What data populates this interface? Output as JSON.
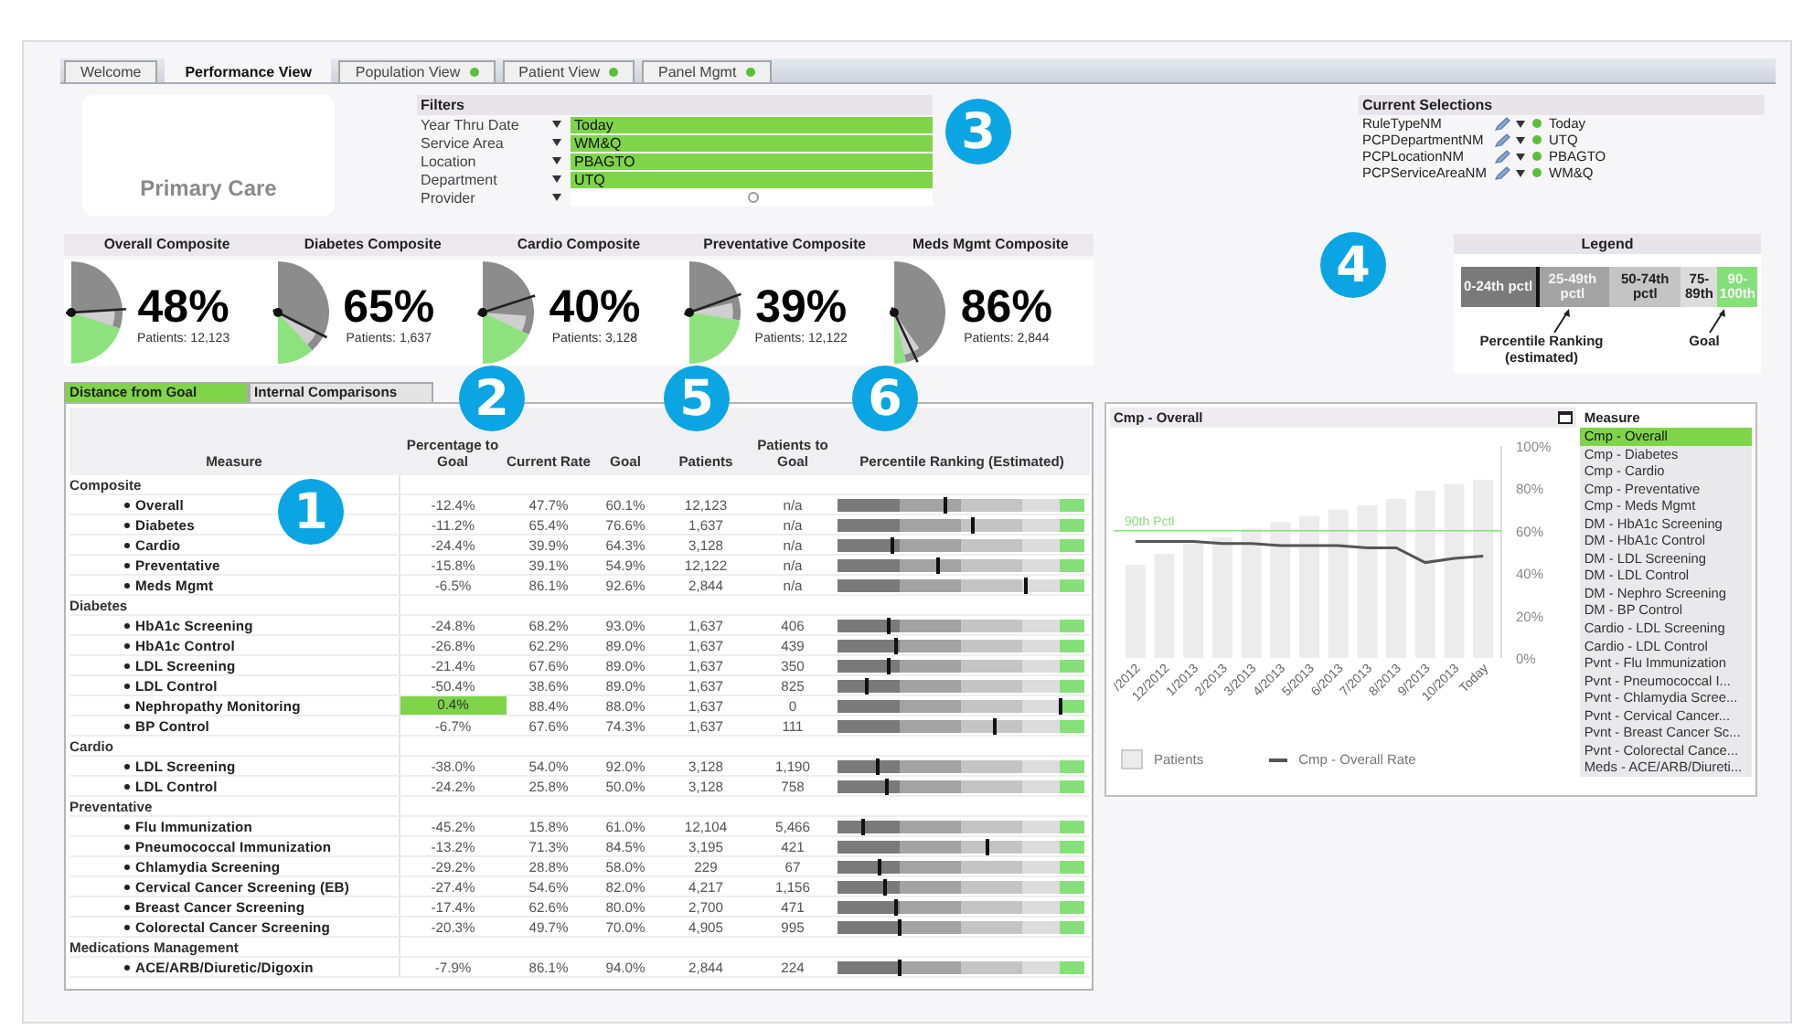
{
  "tabs": [
    {
      "label": "Welcome",
      "selected": false,
      "indicator": false
    },
    {
      "label": "Performance View",
      "selected": true,
      "indicator": false
    },
    {
      "label": "Population View",
      "selected": false,
      "indicator": true
    },
    {
      "label": "Patient View",
      "selected": false,
      "indicator": true
    },
    {
      "label": "Panel Mgmt",
      "selected": false,
      "indicator": true
    }
  ],
  "logo": {
    "title": "Primary Care"
  },
  "filters": {
    "title": "Filters",
    "rows": [
      {
        "label": "Year Thru Date",
        "value": "Today"
      },
      {
        "label": "Service Area",
        "value": "WM&Q"
      },
      {
        "label": "Location",
        "value": "PBAGTO"
      },
      {
        "label": "Department",
        "value": "UTQ"
      },
      {
        "label": "Provider"
      }
    ]
  },
  "current_selections": {
    "title": "Current Selections",
    "rows": [
      {
        "field": "RuleTypeNM",
        "value": "Today"
      },
      {
        "field": "PCPDepartmentNM",
        "value": "UTQ"
      },
      {
        "field": "PCPLocationNM",
        "value": "PBAGTO"
      },
      {
        "field": "PCPServiceAreaNM",
        "value": "WM&Q"
      }
    ]
  },
  "composites": [
    {
      "title": "Overall Composite",
      "value": "48%",
      "patients": "Patients: 12,123"
    },
    {
      "title": "Diabetes Composite",
      "value": "65%",
      "patients": "Patients: 1,637"
    },
    {
      "title": "Cardio Composite",
      "value": "40%",
      "patients": "Patients: 3,128"
    },
    {
      "title": "Preventative Composite",
      "value": "39%",
      "patients": "Patients: 12,122"
    },
    {
      "title": "Meds Mgmt Composite",
      "value": "86%",
      "patients": "Patients: 2,844"
    }
  ],
  "legend": {
    "title": "Legend",
    "segments": [
      {
        "label": "0-24th pctl",
        "color": "#7a7a7a"
      },
      {
        "label": "25-49th pctl",
        "color": "#a3a3a3"
      },
      {
        "label": "50-74th pctl",
        "color": "#c4c4c4"
      },
      {
        "label": "75-89th",
        "color": "#dcdcdc"
      },
      {
        "label": "90-100th",
        "color": "#86e07a"
      }
    ],
    "annotations": [
      "Percentile Ranking (estimated)",
      "Goal"
    ]
  },
  "measure_tabs": [
    {
      "label": "Distance from Goal",
      "selected": true
    },
    {
      "label": "Internal Comparisons",
      "selected": false
    }
  ],
  "table": {
    "columns": [
      "Measure",
      "Percentage to Goal",
      "Current Rate",
      "Goal",
      "Patients",
      "Patients to Goal",
      "Percentile Ranking (Estimated)"
    ],
    "groups": [
      {
        "name": "Composite",
        "rows": [
          {
            "measure": "Overall",
            "pct_to_goal": "-12.4%",
            "current_rate": "47.7%",
            "goal": "60.1%",
            "patients": "12,123",
            "patients_to_goal": "n/a",
            "level": 0.44,
            "highlighted": false
          },
          {
            "measure": "Diabetes",
            "pct_to_goal": "-11.2%",
            "current_rate": "65.4%",
            "goal": "76.6%",
            "patients": "1,637",
            "patients_to_goal": "n/a",
            "level": 0.55,
            "highlighted": false
          },
          {
            "measure": "Cardio",
            "pct_to_goal": "-24.4%",
            "current_rate": "39.9%",
            "goal": "64.3%",
            "patients": "3,128",
            "patients_to_goal": "n/a",
            "level": 0.22,
            "highlighted": false
          },
          {
            "measure": "Preventative",
            "pct_to_goal": "-15.8%",
            "current_rate": "39.1%",
            "goal": "54.9%",
            "patients": "12,122",
            "patients_to_goal": "n/a",
            "level": 0.41,
            "highlighted": false
          },
          {
            "measure": "Meds Mgmt",
            "pct_to_goal": "-6.5%",
            "current_rate": "86.1%",
            "goal": "92.6%",
            "patients": "2,844",
            "patients_to_goal": "n/a",
            "level": 0.76,
            "highlighted": false
          }
        ]
      },
      {
        "name": "Diabetes",
        "rows": [
          {
            "measure": "HbA1c Screening",
            "pct_to_goal": "-24.8%",
            "current_rate": "68.2%",
            "goal": "93.0%",
            "patients": "1,637",
            "patients_to_goal": "406",
            "level": 0.21,
            "highlighted": false
          },
          {
            "measure": "HbA1c Control",
            "pct_to_goal": "-26.8%",
            "current_rate": "62.2%",
            "goal": "89.0%",
            "patients": "1,637",
            "patients_to_goal": "439",
            "level": 0.24,
            "highlighted": false
          },
          {
            "measure": "LDL Screening",
            "pct_to_goal": "-21.4%",
            "current_rate": "67.6%",
            "goal": "89.0%",
            "patients": "1,637",
            "patients_to_goal": "350",
            "level": 0.21,
            "highlighted": false
          },
          {
            "measure": "LDL Control",
            "pct_to_goal": "-50.4%",
            "current_rate": "38.6%",
            "goal": "89.0%",
            "patients": "1,637",
            "patients_to_goal": "825",
            "level": 0.12,
            "highlighted": false
          },
          {
            "measure": "Nephropathy Monitoring",
            "pct_to_goal": "0.4%",
            "current_rate": "88.4%",
            "goal": "88.0%",
            "patients": "1,637",
            "patients_to_goal": "0",
            "level": 0.9,
            "highlighted": true
          },
          {
            "measure": "BP Control",
            "pct_to_goal": "-6.7%",
            "current_rate": "67.6%",
            "goal": "74.3%",
            "patients": "1,637",
            "patients_to_goal": "111",
            "level": 0.64,
            "highlighted": false
          }
        ]
      },
      {
        "name": "Cardio",
        "rows": [
          {
            "measure": "LDL Screening",
            "pct_to_goal": "-38.0%",
            "current_rate": "54.0%",
            "goal": "92.0%",
            "patients": "3,128",
            "patients_to_goal": "1,190",
            "level": 0.16,
            "highlighted": false
          },
          {
            "measure": "LDL Control",
            "pct_to_goal": "-24.2%",
            "current_rate": "25.8%",
            "goal": "50.0%",
            "patients": "3,128",
            "patients_to_goal": "758",
            "level": 0.2,
            "highlighted": false
          }
        ]
      },
      {
        "name": "Preventative",
        "rows": [
          {
            "measure": "Flu Immunization",
            "pct_to_goal": "-45.2%",
            "current_rate": "15.8%",
            "goal": "61.0%",
            "patients": "12,104",
            "patients_to_goal": "5,466",
            "level": 0.1,
            "highlighted": false
          },
          {
            "measure": "Pneumococcal Immunization",
            "pct_to_goal": "-13.2%",
            "current_rate": "71.3%",
            "goal": "84.5%",
            "patients": "3,195",
            "patients_to_goal": "421",
            "level": 0.61,
            "highlighted": false
          },
          {
            "measure": "Chlamydia Screening",
            "pct_to_goal": "-29.2%",
            "current_rate": "28.8%",
            "goal": "58.0%",
            "patients": "229",
            "patients_to_goal": "67",
            "level": 0.17,
            "highlighted": false
          },
          {
            "measure": "Cervical Cancer Screening (EB)",
            "pct_to_goal": "-27.4%",
            "current_rate": "54.6%",
            "goal": "82.0%",
            "patients": "4,217",
            "patients_to_goal": "1,156",
            "level": 0.19,
            "highlighted": false
          },
          {
            "measure": "Breast Cancer Screening",
            "pct_to_goal": "-17.4%",
            "current_rate": "62.6%",
            "goal": "80.0%",
            "patients": "2,700",
            "patients_to_goal": "471",
            "level": 0.24,
            "highlighted": false
          },
          {
            "measure": "Colorectal Cancer Screening",
            "pct_to_goal": "-20.3%",
            "current_rate": "49.7%",
            "goal": "70.0%",
            "patients": "4,905",
            "patients_to_goal": "995",
            "level": 0.25,
            "highlighted": false
          }
        ]
      },
      {
        "name": "Medications Management",
        "rows": [
          {
            "measure": "ACE/ARB/Diuretic/Digoxin",
            "pct_to_goal": "-7.9%",
            "current_rate": "86.1%",
            "goal": "94.0%",
            "patients": "2,844",
            "patients_to_goal": "224",
            "level": 0.25,
            "highlighted": false
          }
        ]
      }
    ]
  },
  "chart_panel": {
    "title": "Cmp - Overall",
    "chart_data": {
      "type": "bar",
      "categories": [
        "/2012",
        "12/2012",
        "1/2013",
        "2/2013",
        "3/2013",
        "4/2013",
        "5/2013",
        "6/2013",
        "7/2013",
        "8/2013",
        "9/2013",
        "10/2013",
        "Today"
      ],
      "series": [
        {
          "name": "Patients",
          "color": "#ececec",
          "values": [
            44,
            49,
            54,
            57,
            61,
            64,
            67,
            70,
            72,
            75,
            79,
            82,
            84
          ]
        },
        {
          "name": "Cmp - Overall Rate",
          "type": "line",
          "color": "#555555",
          "values": [
            55,
            55,
            55,
            54,
            54,
            53,
            53,
            53,
            52,
            52,
            45,
            47,
            48
          ]
        }
      ],
      "legend": "bottom",
      "ylim": [
        0,
        100
      ],
      "yticks": [
        {
          "value": 0,
          "label": "0%"
        },
        {
          "value": 20,
          "label": "20%"
        },
        {
          "value": 40,
          "label": "40%"
        },
        {
          "value": 60,
          "label": "60%"
        },
        {
          "value": 80,
          "label": "80%"
        },
        {
          "value": 100,
          "label": "100%"
        }
      ],
      "ref_lines": [
        {
          "axis": "y",
          "value": 60,
          "label": "90th Pctl",
          "color": "#86e07a"
        }
      ]
    },
    "measure_list": {
      "title": "Measure",
      "items": [
        {
          "label": "Cmp - Overall",
          "selected": true
        },
        {
          "label": "Cmp - Diabetes",
          "selected": false
        },
        {
          "label": "Cmp - Cardio",
          "selected": false
        },
        {
          "label": "Cmp - Preventative",
          "selected": false
        },
        {
          "label": "Cmp - Meds Mgmt",
          "selected": false
        },
        {
          "label": "DM - HbA1c Screening",
          "selected": false
        },
        {
          "label": "DM - HbA1c Control",
          "selected": false
        },
        {
          "label": "DM - LDL Screening",
          "selected": false
        },
        {
          "label": "DM - LDL Control",
          "selected": false
        },
        {
          "label": "DM - Nephro Screening",
          "selected": false
        },
        {
          "label": "DM - BP Control",
          "selected": false
        },
        {
          "label": "Cardio - LDL Screening",
          "selected": false
        },
        {
          "label": "Cardio - LDL Control",
          "selected": false
        },
        {
          "label": "Pvnt - Flu Immunization",
          "selected": false
        },
        {
          "label": "Pvnt - Pneumococcal I...",
          "selected": false
        },
        {
          "label": "Pvnt - Chlamydia Scree...",
          "selected": false
        },
        {
          "label": "Pvnt - Cervical Cancer...",
          "selected": false
        },
        {
          "label": "Pvnt - Breast Cancer Sc...",
          "selected": false
        },
        {
          "label": "Pvnt - Colorectal Cance...",
          "selected": false
        },
        {
          "label": "Meds - ACE/ARB/Diureti...",
          "selected": false
        }
      ]
    }
  },
  "callouts": [
    "1",
    "2",
    "3",
    "4",
    "5",
    "6"
  ]
}
